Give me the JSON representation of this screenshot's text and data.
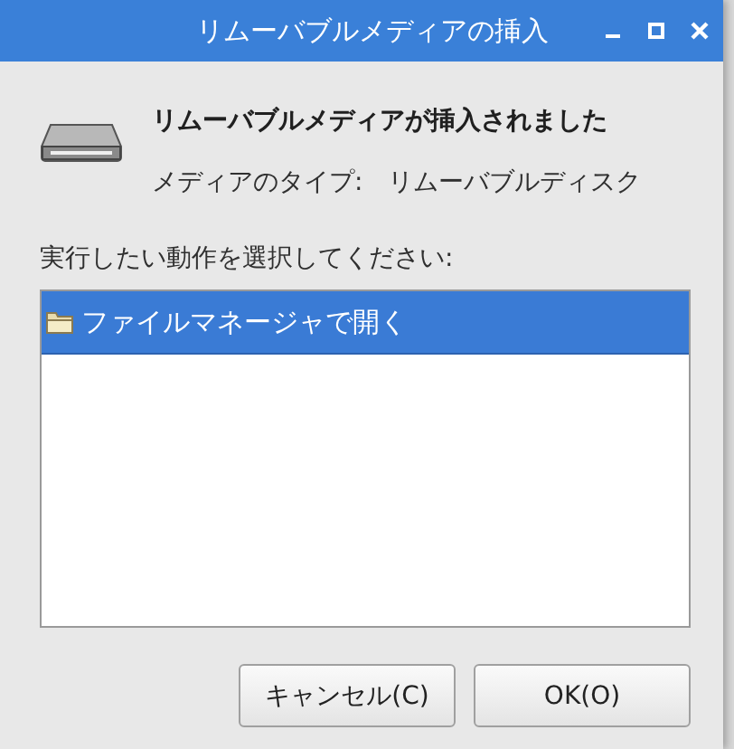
{
  "window": {
    "title": "リムーバブルメディアの挿入"
  },
  "heading": "リムーバブルメディアが挿入されました",
  "media_type": {
    "label": "メディアのタイプ:",
    "value": "リムーバブルディスク"
  },
  "prompt": "実行したい動作を選択してください:",
  "actions": [
    {
      "label": "ファイルマネージャで開く",
      "selected": true
    }
  ],
  "buttons": [
    {
      "label": "キャンセル(C)"
    },
    {
      "label": "OK(O)"
    }
  ]
}
